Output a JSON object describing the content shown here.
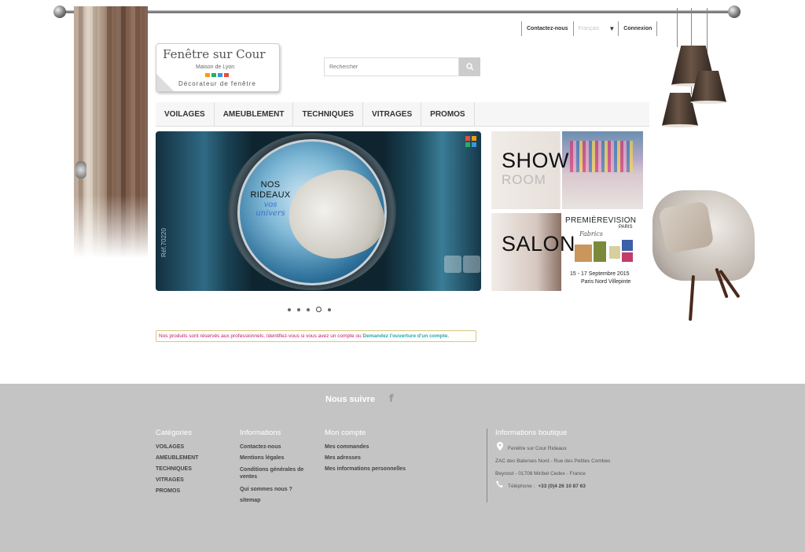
{
  "top_links": {
    "contact": "Contactez-nous",
    "language": "Français",
    "login": "Connexion"
  },
  "logo": {
    "title": "Fenêtre sur Cour",
    "subtitle": "Maison de Lyon",
    "tagline": "Décorateur de fenêtre",
    "dot_colors": [
      "#f39c12",
      "#27ae60",
      "#3498db",
      "#e74c3c"
    ]
  },
  "search": {
    "placeholder": "Rechercher",
    "icon": "search-icon"
  },
  "menu": [
    "VOILAGES",
    "AMEUBLEMENT",
    "TECHNIQUES",
    "VITRAGES",
    "PROMOS"
  ],
  "slider": {
    "line1": "NOS",
    "line2": "RIDEAUX",
    "line3": "vos",
    "line4": "univers",
    "ref": "Réf.70220",
    "slide_count": 5,
    "active_slide": 4
  },
  "tiles": {
    "showroom": {
      "big": "SHOW",
      "small": "ROOM"
    },
    "salon": {
      "big": "SALON",
      "event_title": "PREMIÈREVISION",
      "event_city": "PARIS",
      "event_sub": "Fabrics",
      "event_dates": "15 - 17 Septembre 2015",
      "event_place": "Paris Nord Villepinte"
    }
  },
  "notice": {
    "text": "Nos produits sont réservés aux professionnels. Identifiez-vous si vous avez un compte ou",
    "link": "Demandez l'ouverture d'un compte."
  },
  "footer": {
    "follow": "Nous suivre",
    "follow_icon": "facebook-icon",
    "categories": {
      "title": "Catégories",
      "items": [
        "VOILAGES",
        "AMEUBLEMENT",
        "TECHNIQUES",
        "VITRAGES",
        "PROMOS"
      ]
    },
    "informations": {
      "title": "Informations",
      "items": [
        "Contactez-nous",
        "Mentions légales",
        "Conditions générales de ventes",
        "Qui sommes nous ?",
        "sitemap"
      ]
    },
    "account": {
      "title": "Mon compte",
      "items": [
        "Mes commandes",
        "Mes adresses",
        "Mes informations personnelles"
      ]
    },
    "shop_info": {
      "title": "Informations boutique",
      "name": "Fenêtre sur Cour Rideaux",
      "address1": "ZAC des Baterses Nord - Rue des Petites Combes",
      "address2": "Beynost - 01708 Miribel Cedex - France",
      "phone_label": "Téléphone :",
      "phone": "+33 (0)4 26 10 87 63"
    }
  },
  "colors": {
    "footer_bg": "#c4c4c4",
    "notice_text": "#c2187a",
    "notice_link": "#2aa6b6",
    "menu_bg": "#f6f6f6"
  }
}
